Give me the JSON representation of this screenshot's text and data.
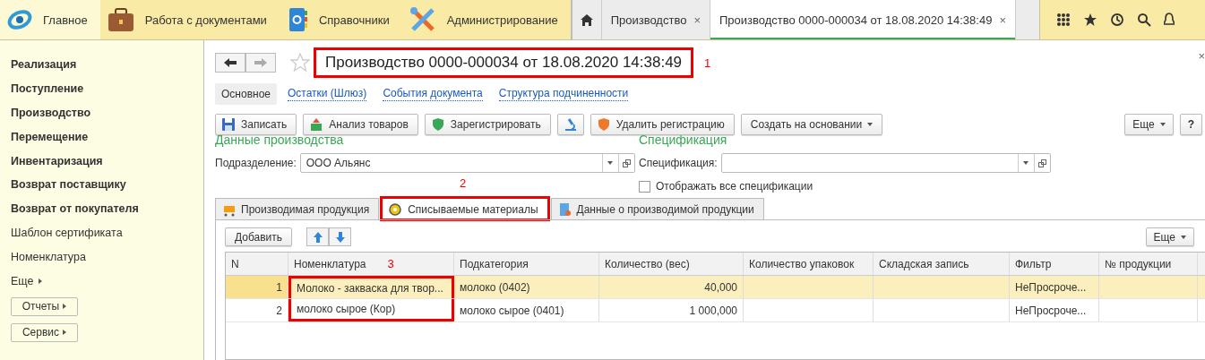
{
  "sections": [
    {
      "label": "Главное",
      "selected": true
    },
    {
      "label": "Работа с документами",
      "selected": false
    },
    {
      "label": "Справочники",
      "selected": false
    },
    {
      "label": "Администрирование",
      "selected": false
    }
  ],
  "open_tabs": [
    {
      "label": "Производство",
      "close": "×",
      "selected": false
    },
    {
      "label": "Производство 0000-000034 от 18.08.2020 14:38:49",
      "close": "×",
      "selected": true
    }
  ],
  "sidebar": {
    "items": [
      {
        "label": "Реализация",
        "bold": true
      },
      {
        "label": "Поступление",
        "bold": true
      },
      {
        "label": "Производство",
        "bold": true
      },
      {
        "label": "Перемещение",
        "bold": true
      },
      {
        "label": "Инвентаризация",
        "bold": true
      },
      {
        "label": "Возврат поставщику",
        "bold": true
      },
      {
        "label": "Возврат от покупателя",
        "bold": true
      },
      {
        "label": "Шаблон сертификата",
        "bold": false
      },
      {
        "label": "Номенклатура",
        "bold": false
      },
      {
        "label": "Еще",
        "bold": false
      }
    ],
    "buttons": [
      "Отчеты",
      "Сервис"
    ]
  },
  "document": {
    "title": "Производство 0000-000034 от 18.08.2020 14:38:49",
    "highlighted": true,
    "annotation": "1",
    "close": "×",
    "views": [
      {
        "label": "Основное",
        "selected": true
      },
      {
        "label": "Остатки (Шлюз)",
        "selected": false
      },
      {
        "label": "События документа",
        "selected": false
      },
      {
        "label": "Структура подчиненности",
        "selected": false
      }
    ],
    "toolbar": [
      {
        "kind": "button",
        "label": "Записать"
      },
      {
        "kind": "button",
        "label": "Анализ товаров"
      },
      {
        "kind": "button",
        "label": "Зарегистрировать"
      },
      {
        "kind": "icon"
      },
      {
        "kind": "button",
        "label": "Удалить регистрацию"
      },
      {
        "kind": "menu",
        "label": "Создать на основании"
      }
    ],
    "toolbar_right": [
      "Еще",
      "?"
    ],
    "production": {
      "heading": "Данные производства",
      "field_label": "Подразделение:",
      "value": "ООО  Альянс"
    },
    "specification": {
      "heading": "Спецификация",
      "field_label": "Спецификация:",
      "checkbox_label": "Отображать все спецификации",
      "checked": false
    },
    "tabs": [
      {
        "label": "Производимая продукция",
        "selected": false,
        "highlighted": false
      },
      {
        "label": "Списываемые материалы",
        "selected": true,
        "highlighted": true,
        "annotation": "2"
      },
      {
        "label": "Данные о производимой продукции",
        "selected": false,
        "highlighted": false
      }
    ],
    "table_toolbar": {
      "add": "Добавить",
      "more": "Еще"
    },
    "table": {
      "columns": [
        {
          "label": "N",
          "highlighted": false
        },
        {
          "label": "Номенклатура",
          "highlighted": true,
          "annotation": "3"
        },
        {
          "label": "Подкатегория",
          "highlighted": false
        },
        {
          "label": "Количество (вес)",
          "highlighted": false
        },
        {
          "label": "Количество упаковок",
          "highlighted": false
        },
        {
          "label": "Складская запись",
          "highlighted": false
        },
        {
          "label": "Фильтр",
          "highlighted": false
        },
        {
          "label": "№ продукции",
          "highlighted": false
        }
      ],
      "rows": [
        {
          "selected": true,
          "cells": [
            "1",
            "Молоко - закваска для твор...",
            "молоко (0402)",
            "40,000",
            "",
            "",
            "НеПросроче...",
            ""
          ]
        },
        {
          "selected": false,
          "cells": [
            "2",
            "молоко сырое (Кор)",
            "молоко сырое (0401)",
            "1 000,000",
            "",
            "",
            "НеПросроче...",
            ""
          ]
        }
      ]
    }
  }
}
